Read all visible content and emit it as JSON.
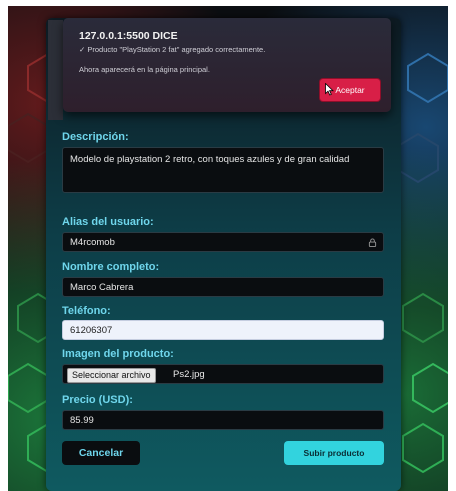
{
  "dialog": {
    "title": "127.0.0.1:5500 DICE",
    "message": "✓ Producto \"PlayStation 2 fat\" agregado correctamente.",
    "submessage": "Ahora aparecerá en la página principal.",
    "accept_label": "Aceptar"
  },
  "form": {
    "description": {
      "label": "Descripción:",
      "value": "Modelo de playstation 2 retro, con toques azules y de gran calidad"
    },
    "alias": {
      "label": "Alias del usuario:",
      "value": "M4rcomob",
      "icon": "lock-icon"
    },
    "full_name": {
      "label": "Nombre completo:",
      "value": "Marco Cabrera"
    },
    "phone": {
      "label": "Teléfono:",
      "value": "61206307"
    },
    "image": {
      "label": "Imagen del producto:",
      "button_label": "Seleccionar archivo",
      "file_name": "Ps2.jpg"
    },
    "price": {
      "label": "Precio (USD):",
      "value": "85.99"
    },
    "cancel_label": "Cancelar",
    "submit_label": "Subir producto"
  },
  "colors": {
    "accent": "#6fd6ec",
    "submit_bg": "#32d3de",
    "dialog_button": "#d81f47"
  }
}
